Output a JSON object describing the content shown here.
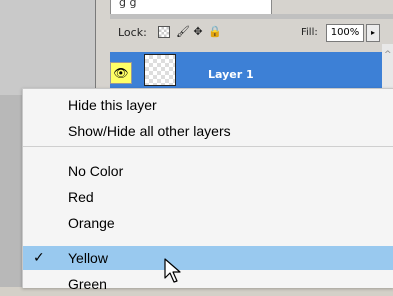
{
  "top_field": {
    "text": "g  g"
  },
  "lock_row": {
    "lock_label": "Lock:",
    "icons": [
      "transparency-lock-icon",
      "brush-icon",
      "move-icon",
      "lock-icon"
    ],
    "fill_label": "Fill:",
    "fill_value": "100%"
  },
  "layer": {
    "name": "Layer 1",
    "visible": true
  },
  "menu": {
    "items": [
      {
        "label": "Hide this layer"
      },
      {
        "label": "Show/Hide all other layers"
      },
      {
        "label": "No Color"
      },
      {
        "label": "Red"
      },
      {
        "label": "Orange"
      },
      {
        "label": "Yellow",
        "checked": true,
        "highlighted": true
      },
      {
        "label": "Green"
      }
    ]
  },
  "colors": {
    "layer_selected": "#3d80d6",
    "menu_highlight": "#99c9ef",
    "eye_box": "#ffff66"
  }
}
